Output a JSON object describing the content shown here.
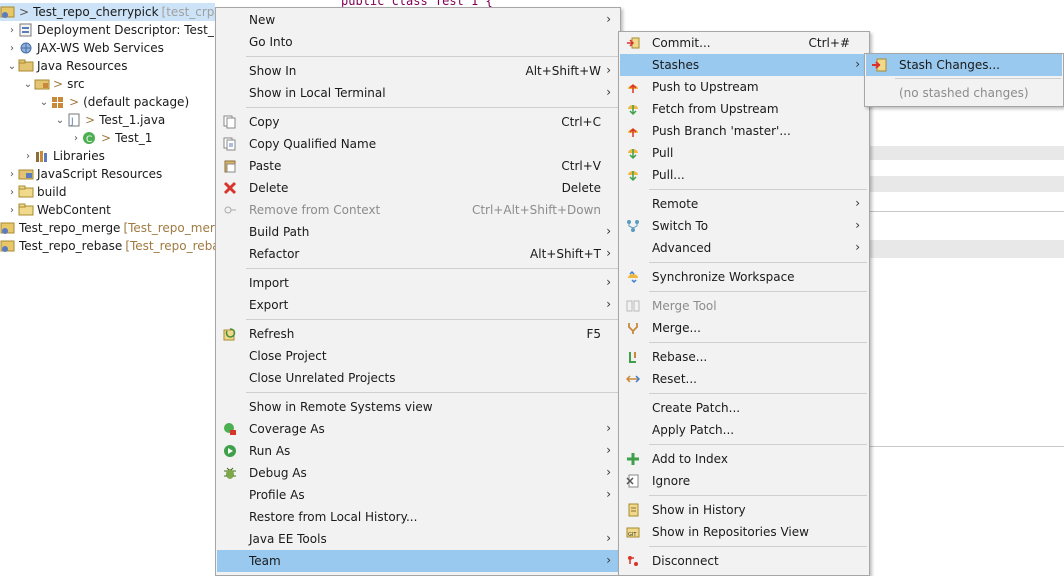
{
  "explorer": {
    "rows": [
      {
        "label": "Test_repo_cherrypick",
        "deco": "[test_crp master]",
        "prefix": ">"
      },
      {
        "label": "Deployment Descriptor: Test_repo_cherrypick"
      },
      {
        "label": "JAX-WS Web Services"
      },
      {
        "label": "Java Resources"
      },
      {
        "label": "src",
        "prefix": ">"
      },
      {
        "label": "(default package)",
        "prefix": ">"
      },
      {
        "label": "Test_1.java",
        "prefix": ">"
      },
      {
        "label": "Test_1",
        "prefix": ">"
      },
      {
        "label": "Libraries"
      },
      {
        "label": "JavaScript Resources"
      },
      {
        "label": "build"
      },
      {
        "label": "WebContent"
      },
      {
        "label": "Test_repo_merge",
        "deco": "[Test_repo_merge master]"
      },
      {
        "label": "Test_repo_rebase",
        "deco": "[Test_repo_rebase master]"
      }
    ]
  },
  "editor": {
    "code_text": "public class Test_1 {"
  },
  "main_menu": {
    "new": "New",
    "go_into": "Go Into",
    "show_in": "Show In",
    "show_in_acc": "Alt+Shift+W",
    "show_local_terminal": "Show in Local Terminal",
    "copy": "Copy",
    "copy_acc": "Ctrl+C",
    "copy_qualified": "Copy Qualified Name",
    "paste": "Paste",
    "paste_acc": "Ctrl+V",
    "delete": "Delete",
    "delete_acc": "Delete",
    "remove_context": "Remove from Context",
    "remove_context_acc": "Ctrl+Alt+Shift+Down",
    "build_path": "Build Path",
    "refactor": "Refactor",
    "refactor_acc": "Alt+Shift+T",
    "import": "Import",
    "export": "Export",
    "refresh": "Refresh",
    "refresh_acc": "F5",
    "close_project": "Close Project",
    "close_unrelated": "Close Unrelated Projects",
    "show_remote": "Show in Remote Systems view",
    "coverage_as": "Coverage As",
    "run_as": "Run As",
    "debug_as": "Debug As",
    "profile_as": "Profile As",
    "restore_history": "Restore from Local History...",
    "java_ee_tools": "Java EE Tools",
    "team": "Team"
  },
  "team_menu": {
    "commit": "Commit...",
    "commit_acc": "Ctrl+#",
    "stashes": "Stashes",
    "push_upstream": "Push to Upstream",
    "fetch_upstream": "Fetch from Upstream",
    "push_branch": "Push Branch 'master'...",
    "pull": "Pull",
    "pull_dots": "Pull...",
    "remote": "Remote",
    "switch_to": "Switch To",
    "advanced": "Advanced",
    "sync_workspace": "Synchronize Workspace",
    "merge_tool": "Merge Tool",
    "merge": "Merge...",
    "rebase": "Rebase...",
    "reset": "Reset...",
    "create_patch": "Create Patch...",
    "apply_patch": "Apply Patch...",
    "add_index": "Add to Index",
    "ignore": "Ignore",
    "show_history": "Show in History",
    "show_repos": "Show in Repositories View",
    "disconnect": "Disconnect"
  },
  "stash_menu": {
    "stash_changes": "Stash Changes...",
    "no_stashed": "(no stashed changes)"
  },
  "colors": {
    "menu_bg": "#f2f2f2",
    "highlight": "#99c9ef",
    "disabled_text": "#8c8c8c",
    "tree_selection": "#cde3f7"
  }
}
